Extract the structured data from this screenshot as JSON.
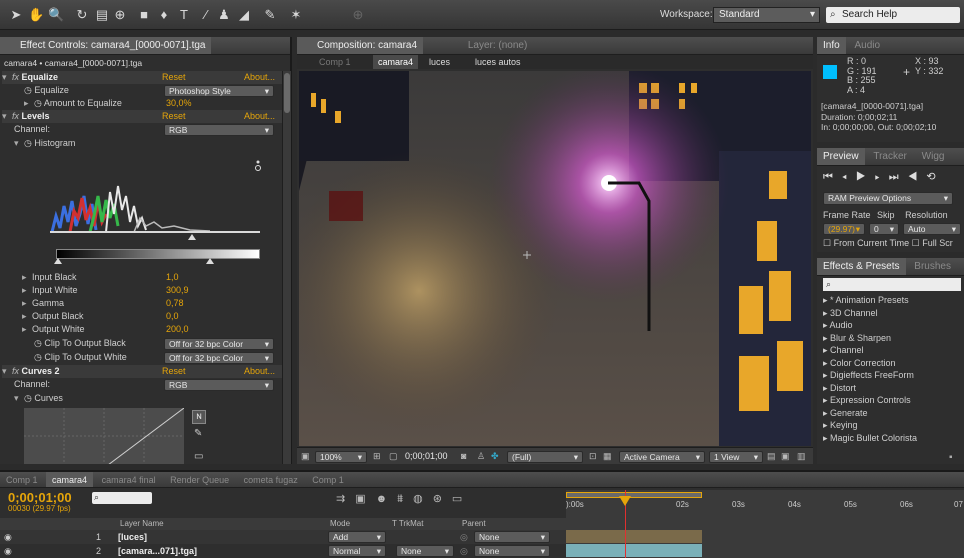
{
  "toolbar": {
    "workspace_label": "Workspace:",
    "workspace_value": "Standard",
    "search_placeholder": "Search Help"
  },
  "effect_controls": {
    "tab_label": "Effect Controls: camara4_[0000-0071].tga",
    "breadcrumb": "camara4 • camara4_[0000-0071].tga",
    "equalize": {
      "name": "Equalize",
      "reset": "Reset",
      "about": "About...",
      "equalize_label": "Equalize",
      "equalize_value": "Photoshop Style",
      "amount_label": "Amount to Equalize",
      "amount_value": "30,0%"
    },
    "levels": {
      "name": "Levels",
      "reset": "Reset",
      "about": "About...",
      "channel_label": "Channel:",
      "channel_value": "RGB",
      "histogram_label": "Histogram",
      "params": [
        {
          "label": "Input Black",
          "value": "1,0"
        },
        {
          "label": "Input White",
          "value": "300,9"
        },
        {
          "label": "Gamma",
          "value": "0,78"
        },
        {
          "label": "Output Black",
          "value": "0,0"
        },
        {
          "label": "Output White",
          "value": "200,0"
        }
      ],
      "clip_black_label": "Clip To Output Black",
      "clip_black_value": "Off for 32 bpc Color",
      "clip_white_label": "Clip To Output White",
      "clip_white_value": "Off for 32 bpc Color"
    },
    "curves": {
      "name": "Curves 2",
      "reset": "Reset",
      "about": "About...",
      "channel_label": "Channel:",
      "channel_value": "RGB",
      "curves_label": "Curves"
    }
  },
  "composition": {
    "tab_label": "Composition: camara4",
    "layer_tab": "Layer: (none)",
    "crumbs": [
      "Comp 1",
      "camara4",
      "luces",
      "luces autos"
    ],
    "zoom": "100%",
    "timecode": "0;00;01;00",
    "resolution": "(Full)",
    "camera": "Active Camera",
    "view": "1 View"
  },
  "info": {
    "tab_info": "Info",
    "tab_audio": "Audio",
    "r": "R : 0",
    "g": "G : 191",
    "b": "B : 255",
    "a": "A : 4",
    "x": "X : 93",
    "y": "Y : 332",
    "swatch_color": "#00bfff",
    "file": "[camara4_[0000-0071].tga]",
    "duration": "Duration: 0;00;02;11",
    "inout": "In: 0;00;00;00, Out: 0;00;02;10"
  },
  "preview": {
    "tab": "Preview",
    "tab2": "Tracker",
    "tab3": "Wigg",
    "ram_options": "RAM Preview Options",
    "frame_rate_label": "Frame Rate",
    "skip_label": "Skip",
    "resolution_label": "Resolution",
    "frame_rate_value": "(29.97)",
    "skip_value": "0",
    "resolution_value": "Auto",
    "from_current": "From Current Time",
    "full_screen": "Full Scr"
  },
  "effects_presets": {
    "tab": "Effects & Presets",
    "tab2": "Brushes",
    "items": [
      "* Animation Presets",
      "3D Channel",
      "Audio",
      "Blur & Sharpen",
      "Channel",
      "Color Correction",
      "Digieffects FreeForm",
      "Distort",
      "Expression Controls",
      "Generate",
      "Keying",
      "Magic Bullet Colorista"
    ]
  },
  "timeline": {
    "tabs": [
      "Comp 1",
      "camara4",
      "camara4 final",
      "Render Queue",
      "cometa fugaz",
      "Comp 1"
    ],
    "timecode": "0;00;01;00",
    "fps": "00030 (29.97 fps)",
    "col_layer": "Layer Name",
    "col_mode": "Mode",
    "col_trkmat": "T  TrkMat",
    "col_parent": "Parent",
    "ruler": [
      "):00s",
      "02s",
      "03s",
      "04s",
      "05s",
      "06s",
      "07"
    ],
    "layers": [
      {
        "num": "1",
        "name": "[luces]",
        "mode": "Add",
        "trkmat": "",
        "parent": "None"
      },
      {
        "num": "2",
        "name": "[camara...071].tga]",
        "mode": "Normal",
        "trkmat": "None",
        "parent": "None"
      }
    ]
  }
}
